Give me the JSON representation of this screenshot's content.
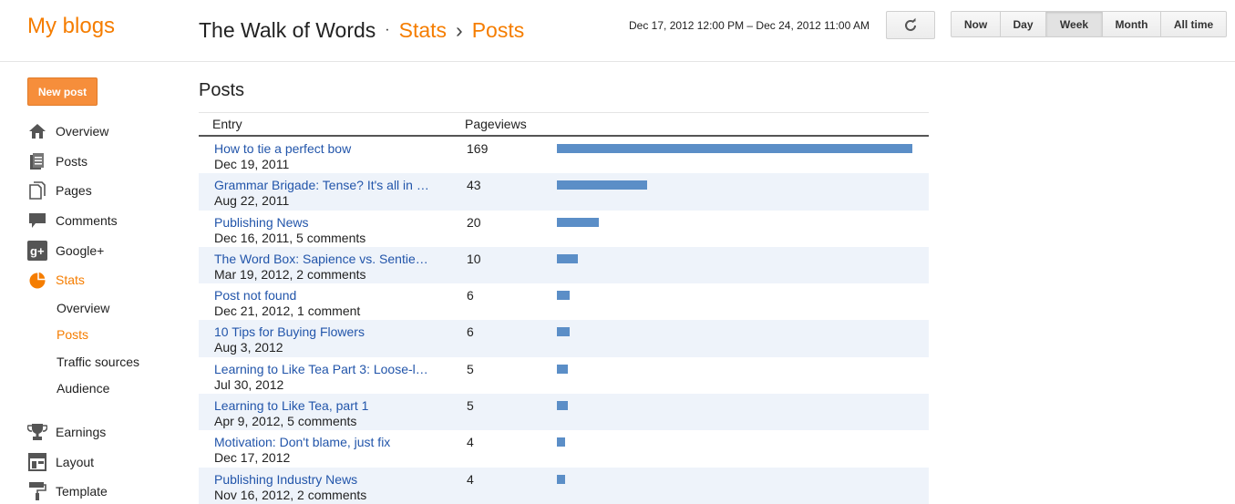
{
  "header": {
    "logo": "My blogs",
    "blog_title": "The Walk of Words",
    "dot": "·",
    "crumb_stats": "Stats",
    "crumb_sep": "›",
    "crumb_posts": "Posts",
    "date_range": "Dec 17, 2012 12:00 PM – Dec 24, 2012 11:00 AM",
    "ranges": [
      {
        "label": "Now",
        "active": false
      },
      {
        "label": "Day",
        "active": false
      },
      {
        "label": "Week",
        "active": true
      },
      {
        "label": "Month",
        "active": false
      },
      {
        "label": "All time",
        "active": false
      }
    ]
  },
  "sidebar": {
    "new_post": "New post",
    "items": [
      {
        "label": "Overview",
        "icon": "home-icon",
        "active": false
      },
      {
        "label": "Posts",
        "icon": "posts-icon",
        "active": false
      },
      {
        "label": "Pages",
        "icon": "pages-icon",
        "active": false
      },
      {
        "label": "Comments",
        "icon": "comment-icon",
        "active": false
      },
      {
        "label": "Google+",
        "icon": "google-plus-icon",
        "active": false
      },
      {
        "label": "Stats",
        "icon": "pie-chart-icon",
        "active": true
      },
      {
        "label": "Earnings",
        "icon": "trophy-icon",
        "active": false
      },
      {
        "label": "Layout",
        "icon": "layout-icon",
        "active": false
      },
      {
        "label": "Template",
        "icon": "paint-roller-icon",
        "active": false
      }
    ],
    "stats_sub": [
      {
        "label": "Overview",
        "active": false
      },
      {
        "label": "Posts",
        "active": true
      },
      {
        "label": "Traffic sources",
        "active": false
      },
      {
        "label": "Audience",
        "active": false
      }
    ]
  },
  "colors": {
    "accent": "#f57d00",
    "link": "#2255aa",
    "bar": "#5b8ec7",
    "row_alt": "#eef3fa"
  },
  "main": {
    "title": "Posts",
    "columns": [
      "Entry",
      "Pageviews"
    ],
    "rows": [
      {
        "title": "How to tie a perfect bow",
        "sub": "Dec 19, 2011",
        "pageviews": 169
      },
      {
        "title": "Grammar Brigade: Tense? It's all in …",
        "sub": "Aug 22, 2011",
        "pageviews": 43
      },
      {
        "title": "Publishing News",
        "sub": "Dec 16, 2011, 5 comments",
        "pageviews": 20
      },
      {
        "title": "The Word Box: Sapience vs. Sentie…",
        "sub": "Mar 19, 2012, 2 comments",
        "pageviews": 10
      },
      {
        "title": "Post not found",
        "sub": "Dec 21, 2012, 1 comment",
        "pageviews": 6
      },
      {
        "title": "10 Tips for Buying Flowers",
        "sub": "Aug 3, 2012",
        "pageviews": 6
      },
      {
        "title": "Learning to Like Tea Part 3: Loose-l…",
        "sub": "Jul 30, 2012",
        "pageviews": 5
      },
      {
        "title": "Learning to Like Tea, part 1",
        "sub": "Apr 9, 2012, 5 comments",
        "pageviews": 5
      },
      {
        "title": "Motivation: Don't blame, just fix",
        "sub": "Dec 17, 2012",
        "pageviews": 4
      },
      {
        "title": "Publishing Industry News",
        "sub": "Nov 16, 2012, 2 comments",
        "pageviews": 4
      }
    ]
  }
}
